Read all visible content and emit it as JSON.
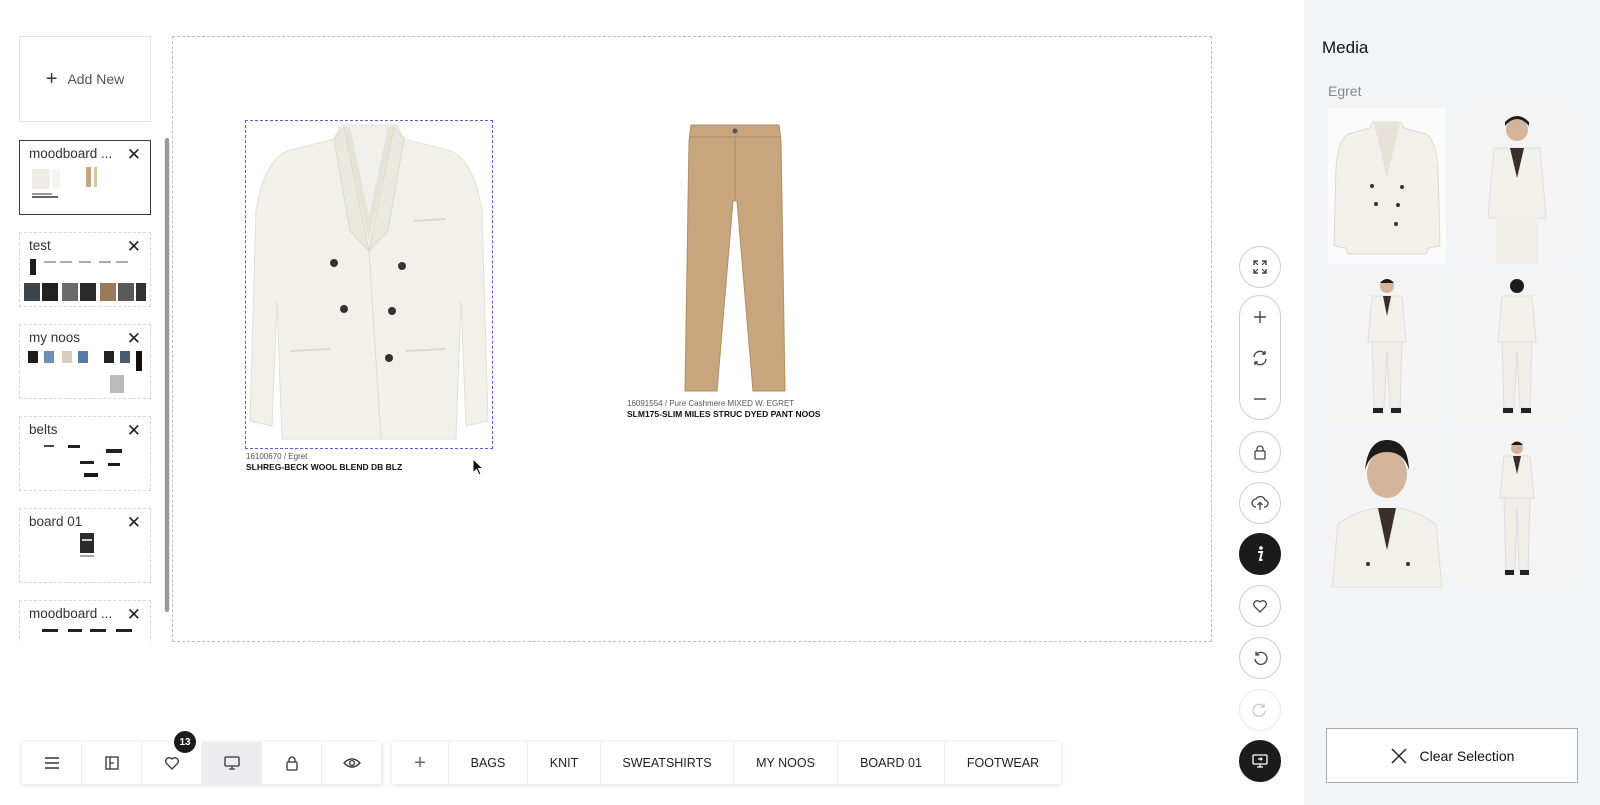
{
  "sidebar": {
    "add_new_label": "Add New",
    "boards": [
      {
        "title": "moodboard ...",
        "active": true
      },
      {
        "title": "test",
        "active": false
      },
      {
        "title": "my noos",
        "active": false
      },
      {
        "title": "belts",
        "active": false
      },
      {
        "title": "board 01",
        "active": false
      },
      {
        "title": "moodboard ...",
        "active": false
      }
    ]
  },
  "canvas": {
    "products": [
      {
        "meta": "16100670 / Egret",
        "name": "SLHREG-BECK WOOL BLEND DB BLZ",
        "color": "#f2f0ea"
      },
      {
        "meta": "16091554 / Pure Cashmere MIXED W. EGRET",
        "name": "SLM175-SLIM MILES STRUC DYED PANT NOOS",
        "color": "#c7a67e"
      }
    ]
  },
  "controls": {
    "icons": [
      "fullscreen-icon",
      "zoom-in-icon",
      "reset-zoom-icon",
      "zoom-out-icon",
      "lock-icon",
      "upload-cloud-icon",
      "info-icon",
      "heart-icon",
      "undo-icon",
      "redo-icon",
      "present-icon"
    ]
  },
  "toolbar": {
    "favorites_count": "13",
    "tabs": [
      "BAGS",
      "KNIT",
      "SWEATSHIRTS",
      "MY NOOS",
      "BOARD 01",
      "FOOTWEAR"
    ]
  },
  "media": {
    "title": "Media",
    "subtitle": "Egret",
    "clear_label": "Clear Selection"
  },
  "colors": {
    "accent_dark": "#1b1b1b",
    "selection": "#5b5bf0",
    "panel_bg": "#f3f4f8"
  }
}
